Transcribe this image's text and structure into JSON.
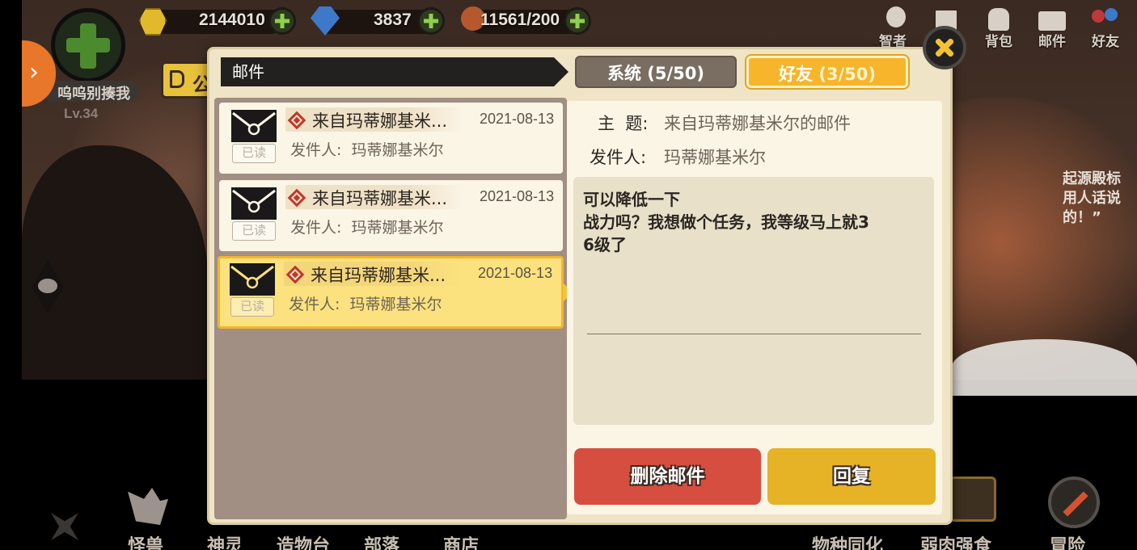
{
  "player": {
    "name": "呜呜别揍我",
    "level": "Lv.34"
  },
  "resources": [
    {
      "name": "gold",
      "icon": "gold-ingot-icon",
      "value": "2144010"
    },
    {
      "name": "gem",
      "icon": "blue-gem-icon",
      "value": "3837"
    },
    {
      "name": "stamina",
      "icon": "meat-icon",
      "value": "11561/200"
    }
  ],
  "top_menu": [
    {
      "label": "智者",
      "icon": "lightbulb-icon"
    },
    {
      "label": "",
      "icon": "cards-icon"
    },
    {
      "label": "背包",
      "icon": "backpack-icon"
    },
    {
      "label": "邮件",
      "icon": "mail-icon"
    },
    {
      "label": "好友",
      "icon": "friends-icon"
    }
  ],
  "announcement_fragment": "公",
  "side_text": "起源殿标\n用人话说\n的！”",
  "bottom_nav": [
    "怪兽",
    "神灵",
    "造物台",
    "部落",
    "商店",
    "物种同化",
    "弱肉强食",
    "冒险"
  ],
  "dialog": {
    "title": "邮件",
    "tabs": {
      "system": {
        "label": "系统",
        "count": "(5/50)"
      },
      "friend": {
        "label": "好友",
        "count": "(3/50)"
      }
    },
    "mails": [
      {
        "subject": "来自玛蒂娜基米...",
        "date": "2021-08-13",
        "read_badge": "已读",
        "sender_label": "发件人:",
        "sender": "玛蒂娜基米尔",
        "selected": false
      },
      {
        "subject": "来自玛蒂娜基米...",
        "date": "2021-08-13",
        "read_badge": "已读",
        "sender_label": "发件人:",
        "sender": "玛蒂娜基米尔",
        "selected": false
      },
      {
        "subject": "来自玛蒂娜基米...",
        "date": "2021-08-13",
        "read_badge": "已读",
        "sender_label": "发件人:",
        "sender": "玛蒂娜基米尔",
        "selected": true
      }
    ],
    "detail": {
      "subject_label": "主  题:",
      "subject": "来自玛蒂娜基米尔的邮件",
      "sender_label": "发件人:",
      "sender": "玛蒂娜基米尔",
      "message": "可以降低一下\n战力吗？我想做个任务，我等级马上就3\n6级了"
    },
    "buttons": {
      "delete": "删除邮件",
      "reply": "回复"
    }
  },
  "colors": {
    "accent_yellow": "#f6b52b",
    "delete_red": "#d64e3f",
    "reply_gold": "#e5b325",
    "panel_cream": "#fbf5e6"
  }
}
